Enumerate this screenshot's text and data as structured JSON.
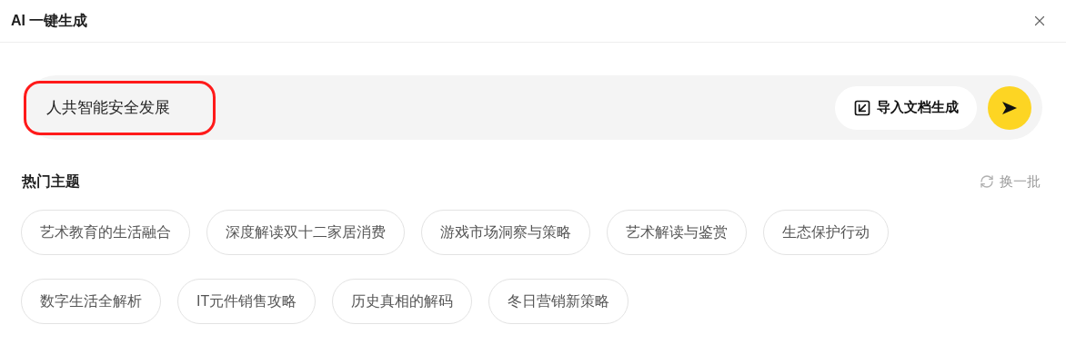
{
  "dialog": {
    "title": "AI 一键生成"
  },
  "prompt": {
    "value": "人共智能安全发展",
    "highlighted": true
  },
  "import_button": {
    "label": "导入文档生成"
  },
  "topics": {
    "title": "热门主题",
    "refresh": "换一批",
    "items": [
      {
        "label": "艺术教育的生活融合"
      },
      {
        "label": "深度解读双十二家居消费"
      },
      {
        "label": "游戏市场洞察与策略"
      },
      {
        "label": "艺术解读与鉴赏"
      },
      {
        "label": "生态保护行动"
      },
      {
        "label": "数字生活全解析"
      },
      {
        "label": "IT元件销售攻略"
      },
      {
        "label": "历史真相的解码"
      },
      {
        "label": "冬日营销新策略"
      }
    ]
  }
}
